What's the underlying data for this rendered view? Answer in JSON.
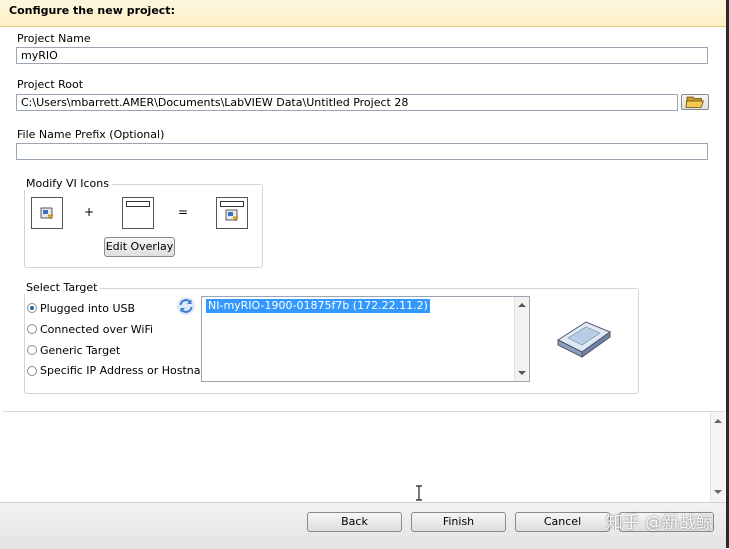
{
  "header": {
    "title": "Configure the new project:"
  },
  "project_name": {
    "label": "Project Name",
    "value": "myRIO"
  },
  "project_root": {
    "label": "Project Root",
    "value": "C:\\Users\\mbarrett.AMER\\Documents\\LabVIEW Data\\Untitled Project 28"
  },
  "prefix": {
    "label": "File Name Prefix (Optional)",
    "value": ""
  },
  "modify_icons": {
    "title": "Modify VI Icons",
    "plus": "+",
    "equals": "=",
    "edit_overlay_label": "Edit Overlay"
  },
  "select_target": {
    "title": "Select Target",
    "options": [
      "Plugged into USB",
      "Connected over WiFi",
      "Generic Target",
      "Specific IP Address or Hostname"
    ],
    "selected_index": 0,
    "list_items": [
      "NI-myRIO-1900-01875f7b (172.22.11.2)"
    ]
  },
  "footer": {
    "back_label": "Back",
    "finish_label": "Finish",
    "cancel_label": "Cancel"
  },
  "watermark": "知乎 @新战鲸",
  "colors": {
    "header_bg": "#fbefc4",
    "selection": "#3399ff",
    "radio_dot": "#2b62b8"
  }
}
